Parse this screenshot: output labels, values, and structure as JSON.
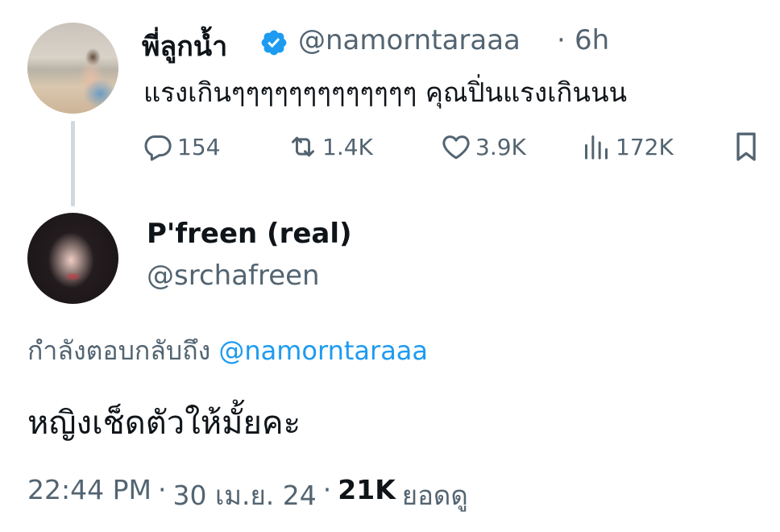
{
  "original_tweet": {
    "display_name": "พี่ลูกน้ำ",
    "handle": "@namorntaraaa",
    "separator": "·",
    "time_ago": "6h",
    "text": "แรงเกินๆๆๆๆๆๆๆๆๆๆๆๆๆ คุณปิ่นแรงเกินนน",
    "verified": true,
    "metrics": {
      "replies": "154",
      "retweets": "1.4K",
      "likes": "3.9K",
      "views": "172K"
    }
  },
  "reply_tweet": {
    "display_name": "P'freen (real)",
    "handle": "@srchafreen",
    "replying_to_label": "กำลังตอบกลับถึง",
    "replying_to_handle": "@namorntaraaa",
    "text": "หญิงเช็ดตัวให้มั้ยคะ",
    "timestamp": {
      "time": "22:44 PM",
      "separator": "·",
      "date": "30 เม.ย. 24",
      "views_count": "21K",
      "views_label": "ยอดดู"
    }
  },
  "colors": {
    "text_primary": "#0f1419",
    "text_secondary": "#536471",
    "accent_blue": "#1d9bf0",
    "thread_line": "#cfd9de"
  },
  "icons": {
    "reply": "speech-bubble-icon",
    "retweet": "retweet-icon",
    "like": "heart-icon",
    "views": "bar-chart-icon",
    "bookmark": "bookmark-icon",
    "verified": "verified-badge-icon"
  }
}
